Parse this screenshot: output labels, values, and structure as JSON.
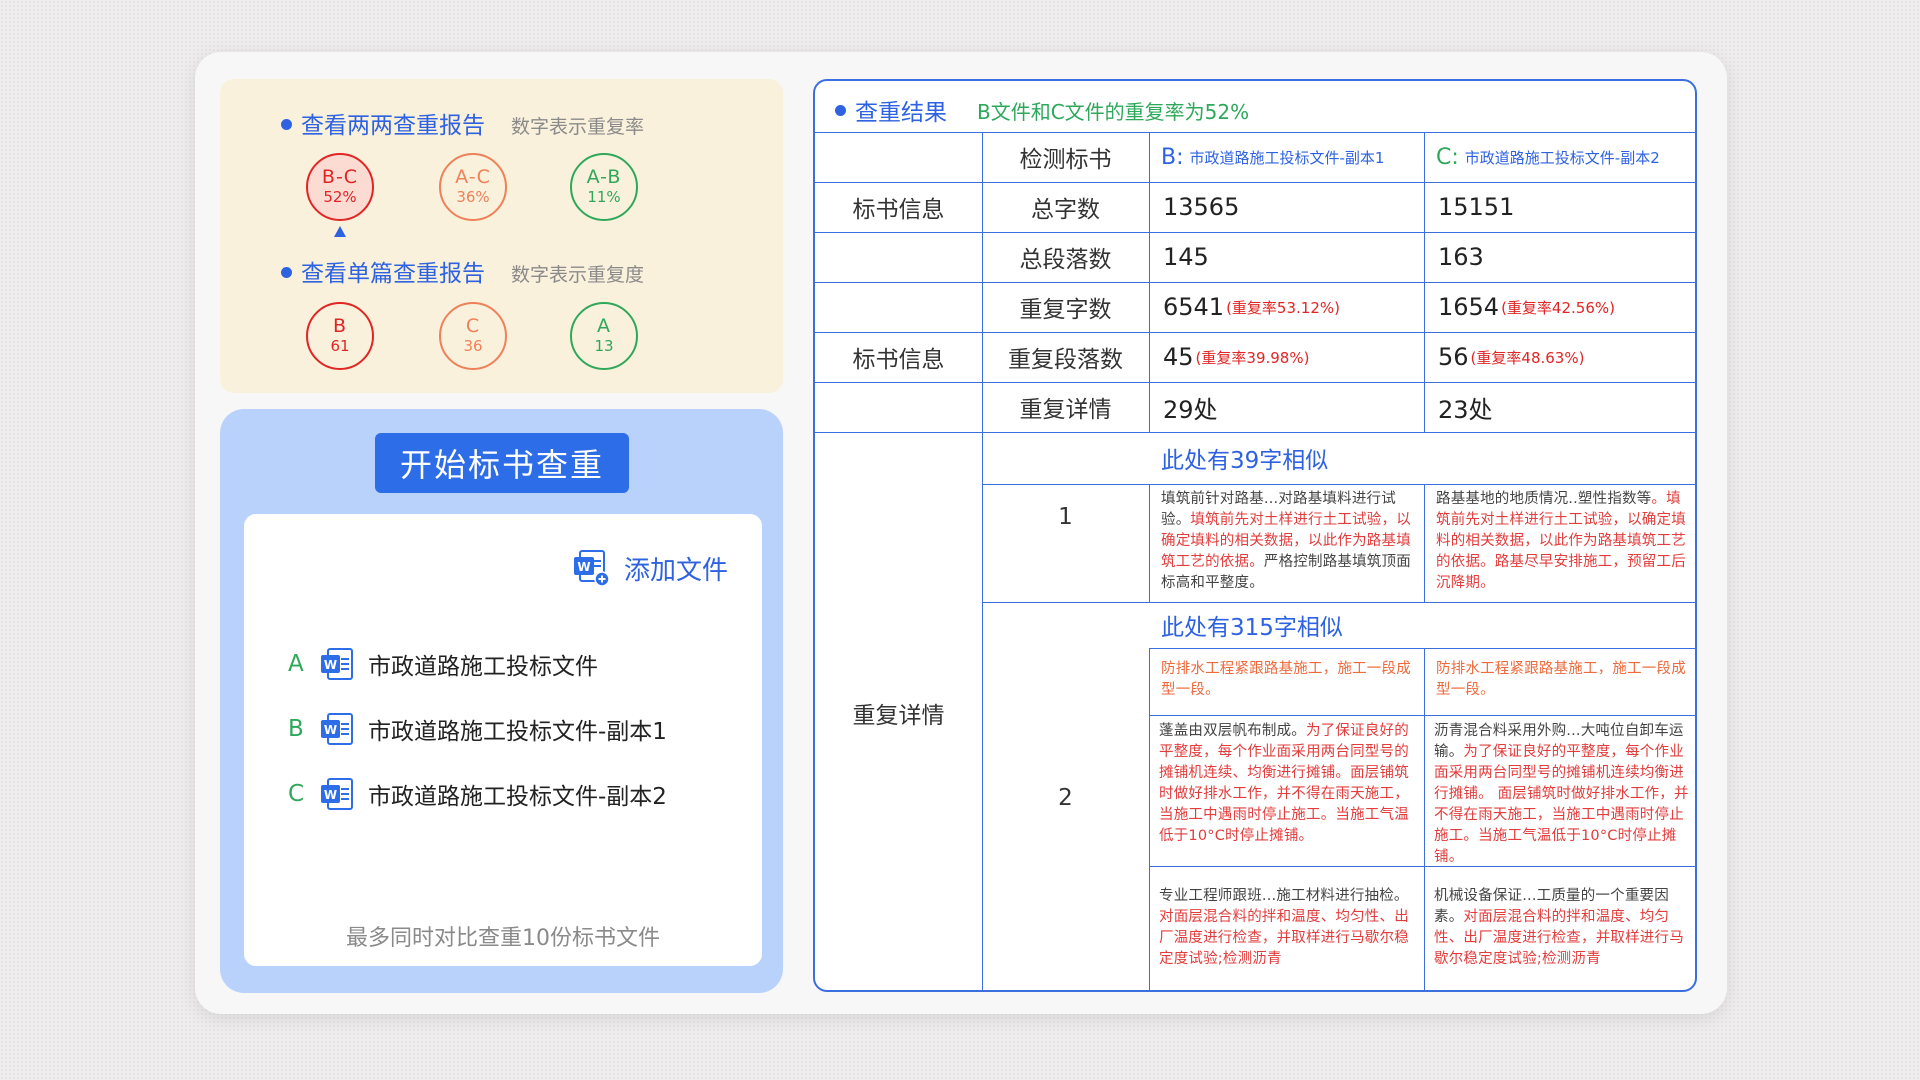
{
  "pairwise": {
    "title": "查看两两查重报告",
    "hint": "数字表示重复率",
    "items": [
      {
        "label": "B-C",
        "value": "52%"
      },
      {
        "label": "A-C",
        "value": "36%"
      },
      {
        "label": "A-B",
        "value": "11%"
      }
    ]
  },
  "single": {
    "title": "查看单篇查重报告",
    "hint": "数字表示重复度",
    "items": [
      {
        "label": "B",
        "value": "61"
      },
      {
        "label": "C",
        "value": "36"
      },
      {
        "label": "A",
        "value": "13"
      }
    ]
  },
  "upload": {
    "start_label": "开始标书查重",
    "add_label": "添加文件",
    "files": [
      {
        "letter": "A",
        "name": "市政道路施工投标文件"
      },
      {
        "letter": "B",
        "name": "市政道路施工投标文件-副本1"
      },
      {
        "letter": "C",
        "name": "市政道路施工投标文件-副本2"
      }
    ],
    "footnote": "最多同时对比查重10份标书文件"
  },
  "result": {
    "title": "查重结果",
    "summary": "B文件和C文件的重复率为52%",
    "col_header": "检测标书",
    "doc_b": {
      "letter": "B:",
      "name": "市政道路施工投标文件-副本1"
    },
    "doc_c": {
      "letter": "C:",
      "name": "市政道路施工投标文件-副本2"
    },
    "group_info_1": "标书信息",
    "group_info_2": "标书信息",
    "group_detail": "重复详情",
    "rows": {
      "total_chars": {
        "label": "总字数",
        "b": "13565",
        "c": "15151"
      },
      "total_paras": {
        "label": "总段落数",
        "b": "145",
        "c": "163"
      },
      "dup_chars": {
        "label": "重复字数",
        "b": "6541",
        "b_rate": "(重复率53.12%)",
        "c": "1654",
        "c_rate": "(重复率42.56%)"
      },
      "dup_paras": {
        "label": "重复段落数",
        "b": "45",
        "b_rate": "(重复率39.98%)",
        "c": "56",
        "c_rate": "(重复率48.63%)"
      },
      "dup_detail": {
        "label": "重复详情",
        "b": "29处",
        "c": "23处"
      }
    },
    "matches": [
      {
        "index": "1",
        "title": "此处有39字相似",
        "b_plain": "填筑前针对路基...对路基填料进行试验。",
        "b_hit": "填筑前先对土样进行土工试验，以确定填料的相关数据，以此作为路基填筑工艺的依据。",
        "b_tail": "严格控制路基填筑顶面标高和平整度。",
        "c_plain": "路基基地的地质情况..塑性指数等",
        "c_hit": "。填筑前先对土样进行土工试验，以确定填料的相关数据，以此作为路基填筑工艺的依据。路基尽早安排施工，预留工后沉降期。",
        "c_tail": ""
      },
      {
        "index": "2",
        "title": "此处有315字相似",
        "p1_b": "防排水工程紧跟路基施工，施工一段成型一段。",
        "p1_c": "防排水工程紧跟路基施工，施工一段成型一段。",
        "p2_b_plain": "蓬盖由双层帆布制成。",
        "p2_b_hit": "为了保证良好的平整度，每个作业面采用两台同型号的摊铺机连续、均衡进行摊铺。面层铺筑时做好排水工作，并不得在雨天施工，当施工中遇雨时停止施工。当施工气温低于10°C时停止摊铺。",
        "p2_c_plain": "沥青混合料采用外购...大吨位自卸车运输。",
        "p2_c_hit": "为了保证良好的平整度，每个作业面采用两台同型号的摊铺机连续均衡进行摊铺。 面层铺筑时做好排水工作，并不得在雨天施工，当施工中遇雨时停止施工。当施工气温低于10°C时停止摊铺。",
        "p3_b_plain": "专业工程师跟班...施工材料进行抽检。",
        "p3_b_hit": "对面层混合料的拌和温度、均匀性、出厂温度进行检查，并取样进行马歇尔稳定度试验;检测沥青",
        "p3_c_plain": "机械设备保证...工质量的一个重要因素。",
        "p3_c_hit": "对面层混合料的拌和温度、均匀性、出厂温度进行检查，并取样进行马歇尔稳定度试验;检测沥青"
      }
    ]
  },
  "colors": {
    "accent": "#2e62e0",
    "red": "#e12525",
    "orange": "#ee8159",
    "green": "#2ea85a"
  }
}
